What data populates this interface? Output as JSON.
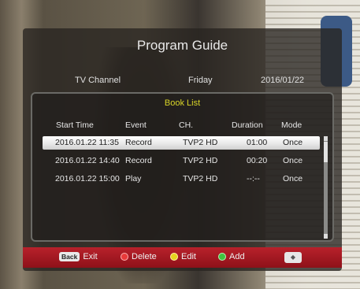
{
  "header": {
    "title": "Program Guide",
    "channel": "TV Channel",
    "day": "Friday",
    "date": "2016/01/22"
  },
  "book_list": {
    "title": "Book List",
    "columns": [
      "Start Time",
      "Event",
      "CH.",
      "Duration",
      "Mode"
    ],
    "rows": [
      {
        "start": "2016.01.22 11:35",
        "event": "Record",
        "channel": "TVP2 HD",
        "duration": "01:00",
        "mode": "Once"
      },
      {
        "start": "2016.01.22 14:40",
        "event": "Record",
        "channel": "TVP2 HD",
        "duration": "00:20",
        "mode": "Once"
      },
      {
        "start": "2016.01.22 15:00",
        "event": "Play",
        "channel": "TVP2 HD",
        "duration": "--:--",
        "mode": "Once"
      }
    ],
    "selected_row": 0
  },
  "footer": {
    "back_key": "Back",
    "exit": "Exit",
    "delete": "Delete",
    "edit": "Edit",
    "add": "Add",
    "nav_icon": "dpad-icon"
  },
  "colors": {
    "footer": "#b8212b",
    "panel_title": "#d8d428"
  }
}
